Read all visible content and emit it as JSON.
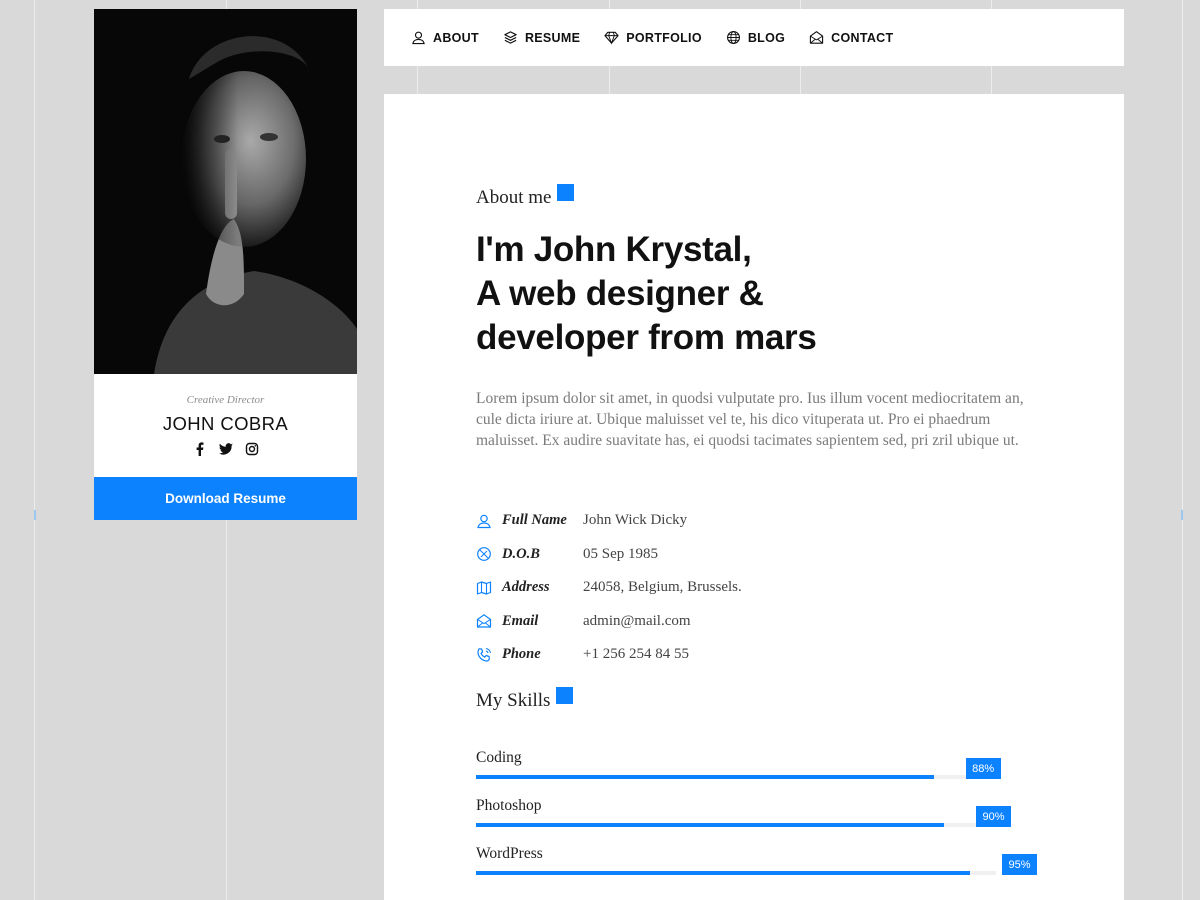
{
  "profile": {
    "role": "Creative Director",
    "name": "JOHN COBRA",
    "download_label": "Download Resume",
    "socials": [
      "facebook-icon",
      "twitter-icon",
      "instagram-icon"
    ]
  },
  "nav": {
    "items": [
      {
        "label": "ABOUT",
        "icon": "user-icon"
      },
      {
        "label": "RESUME",
        "icon": "layers-icon"
      },
      {
        "label": "PORTFOLIO",
        "icon": "diamond-icon"
      },
      {
        "label": "BLOG",
        "icon": "globe-icon"
      },
      {
        "label": "CONTACT",
        "icon": "envelope-open-icon"
      }
    ]
  },
  "about": {
    "section_title": "About me",
    "headline": [
      "I'm John Krystal,",
      "A web designer &",
      "developer from mars"
    ],
    "bio": "Lorem ipsum dolor sit amet, in quodsi vulputate pro. Ius illum vocent mediocritatem an, cule dicta iriure at. Ubique maluisset vel te, his dico vituperata ut. Pro ei phaedrum maluisset. Ex audire suavitate has, ei quodsi tacimates sapientem sed, pri zril ubique ut.",
    "info": [
      {
        "label": "Full Name",
        "value": "John Wick Dicky",
        "icon": "user-icon"
      },
      {
        "label": "D.O.B",
        "value": "05 Sep 1985",
        "icon": "calendar-icon"
      },
      {
        "label": "Address",
        "value": "24058, Belgium, Brussels.",
        "icon": "map-icon"
      },
      {
        "label": "Email",
        "value": "admin@mail.com",
        "icon": "envelope-open-icon"
      },
      {
        "label": "Phone",
        "value": "+1 256 254 84 55",
        "icon": "phone-icon"
      }
    ]
  },
  "skills": {
    "section_title": "My Skills",
    "items": [
      {
        "name": "Coding",
        "percent": 88,
        "label": "88%"
      },
      {
        "name": "Photoshop",
        "percent": 90,
        "label": "90%"
      },
      {
        "name": "WordPress",
        "percent": 95,
        "label": "95%"
      }
    ]
  },
  "colors": {
    "accent": "#0d82ff",
    "background": "#d9d9d9"
  }
}
